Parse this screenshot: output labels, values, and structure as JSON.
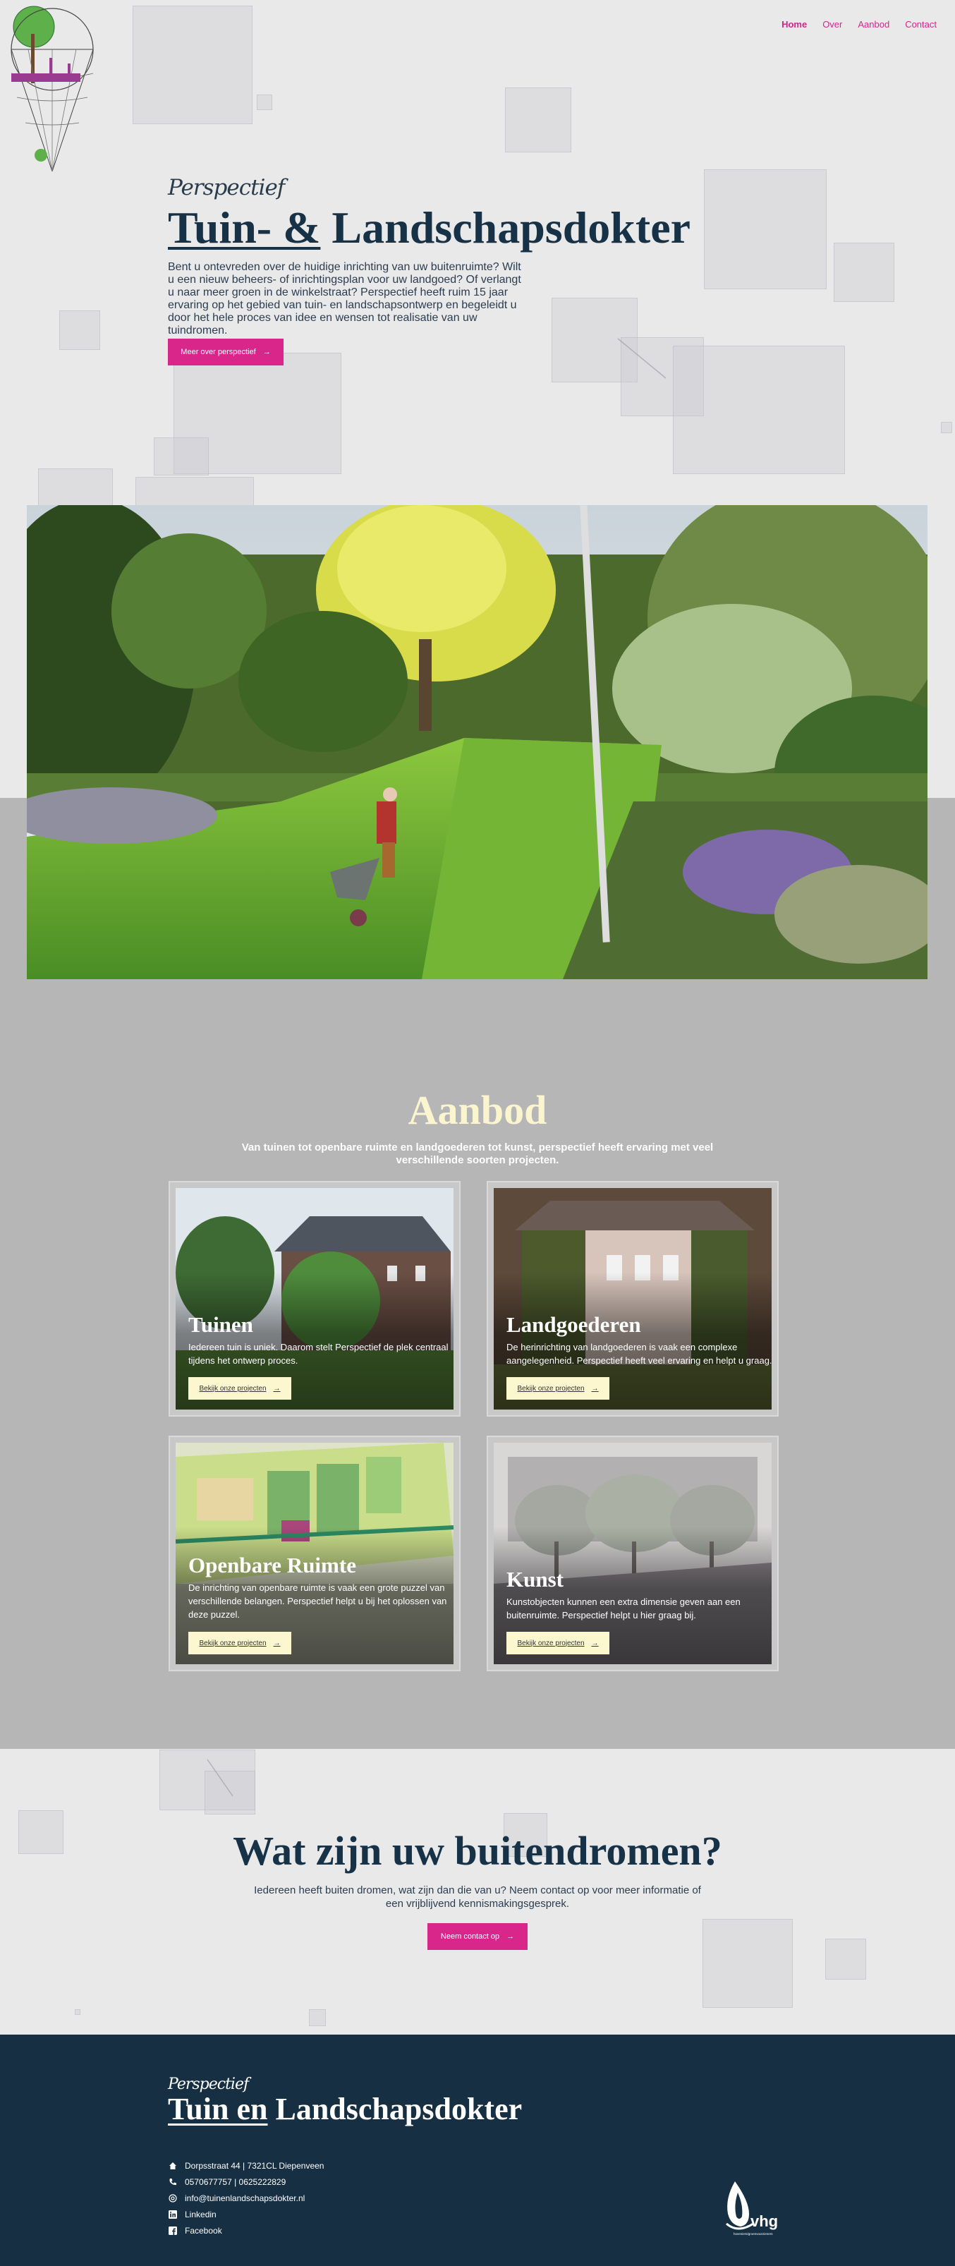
{
  "nav": {
    "items": [
      "Home",
      "Over",
      "Aanbod",
      "Contact"
    ],
    "active": "Home"
  },
  "hero": {
    "kicker": "Perspectief",
    "title_part1": "Tuin- &",
    "title_part2": " Landschapsdokter",
    "text": "Bent u ontevreden over de huidige inrichting van uw buitenruimte? Wilt u een nieuw beheers- of inrichtingsplan voor uw landgoed? Of verlangt u naar meer groen in de winkelstraat? Perspectief heeft ruim 15 jaar ervaring op het gebied van tuin- en landschapsontwerp en begeleidt u door het hele proces van idee en wensen tot realisatie van uw tuindromen.",
    "button": "Meer over perspectief",
    "arrow": "→"
  },
  "aanbod": {
    "title": "Aanbod",
    "subtitle": "Van tuinen tot openbare ruimte en landgoederen tot kunst, perspectief heeft ervaring met veel verschillende soorten projecten.",
    "cards": [
      {
        "title": "Tuinen",
        "text": "Iedereen tuin is uniek. Daarom stelt Perspectief de plek centraal tijdens het ontwerp proces.",
        "button": "Bekijk onze projecten",
        "arrow": "→"
      },
      {
        "title": "Landgoederen",
        "text": "De herinrichting van landgoederen is vaak een complexe aangelegenheid. Perspectief heeft veel ervaring en helpt u graag.",
        "button": "Bekijk onze projecten",
        "arrow": "→"
      },
      {
        "title": "Openbare Ruimte",
        "text": "De inrichting van openbare ruimte is vaak een grote puzzel van verschillende belangen. Perspectief helpt u bij het oplossen van deze puzzel.",
        "button": "Bekijk onze projecten",
        "arrow": "→"
      },
      {
        "title": "Kunst",
        "text": "Kunstobjecten kunnen een extra dimensie geven aan een buitenruimte. Perspectief helpt u hier graag bij.",
        "button": "Bekijk onze projecten",
        "arrow": "→"
      }
    ]
  },
  "dreams": {
    "title": "Wat zijn uw buitendromen?",
    "text": "Iedereen heeft buiten dromen, wat zijn dan die van u? Neem contact op voor meer informatie of een vrijblijvend kennismakingsgesprek.",
    "button": "Neem contact op",
    "arrow": "→"
  },
  "footer": {
    "kicker": "Perspectief",
    "title_part1": "Tuin en",
    "title_part2": " Landschapsdokter",
    "contacts": [
      {
        "icon": "home-icon",
        "text": "Dorpsstraat 44 | 7321CL Diepenveen"
      },
      {
        "icon": "phone-icon",
        "text": "0570677757 | 0625222829"
      },
      {
        "icon": "at-icon",
        "text": "info@tuinenlandschapsdokter.nl"
      },
      {
        "icon": "linkedin-icon",
        "text": "Linkedin"
      },
      {
        "icon": "facebook-icon",
        "text": "Facebook"
      }
    ],
    "badge": {
      "name": "vhg",
      "sub": "hoveniers/groenvoorzieners"
    }
  },
  "colors": {
    "accent": "#d8268b",
    "navy": "#162f43",
    "cream": "#fdf7cf",
    "background": "#e9e9ea",
    "band": "#b6b6b7"
  }
}
